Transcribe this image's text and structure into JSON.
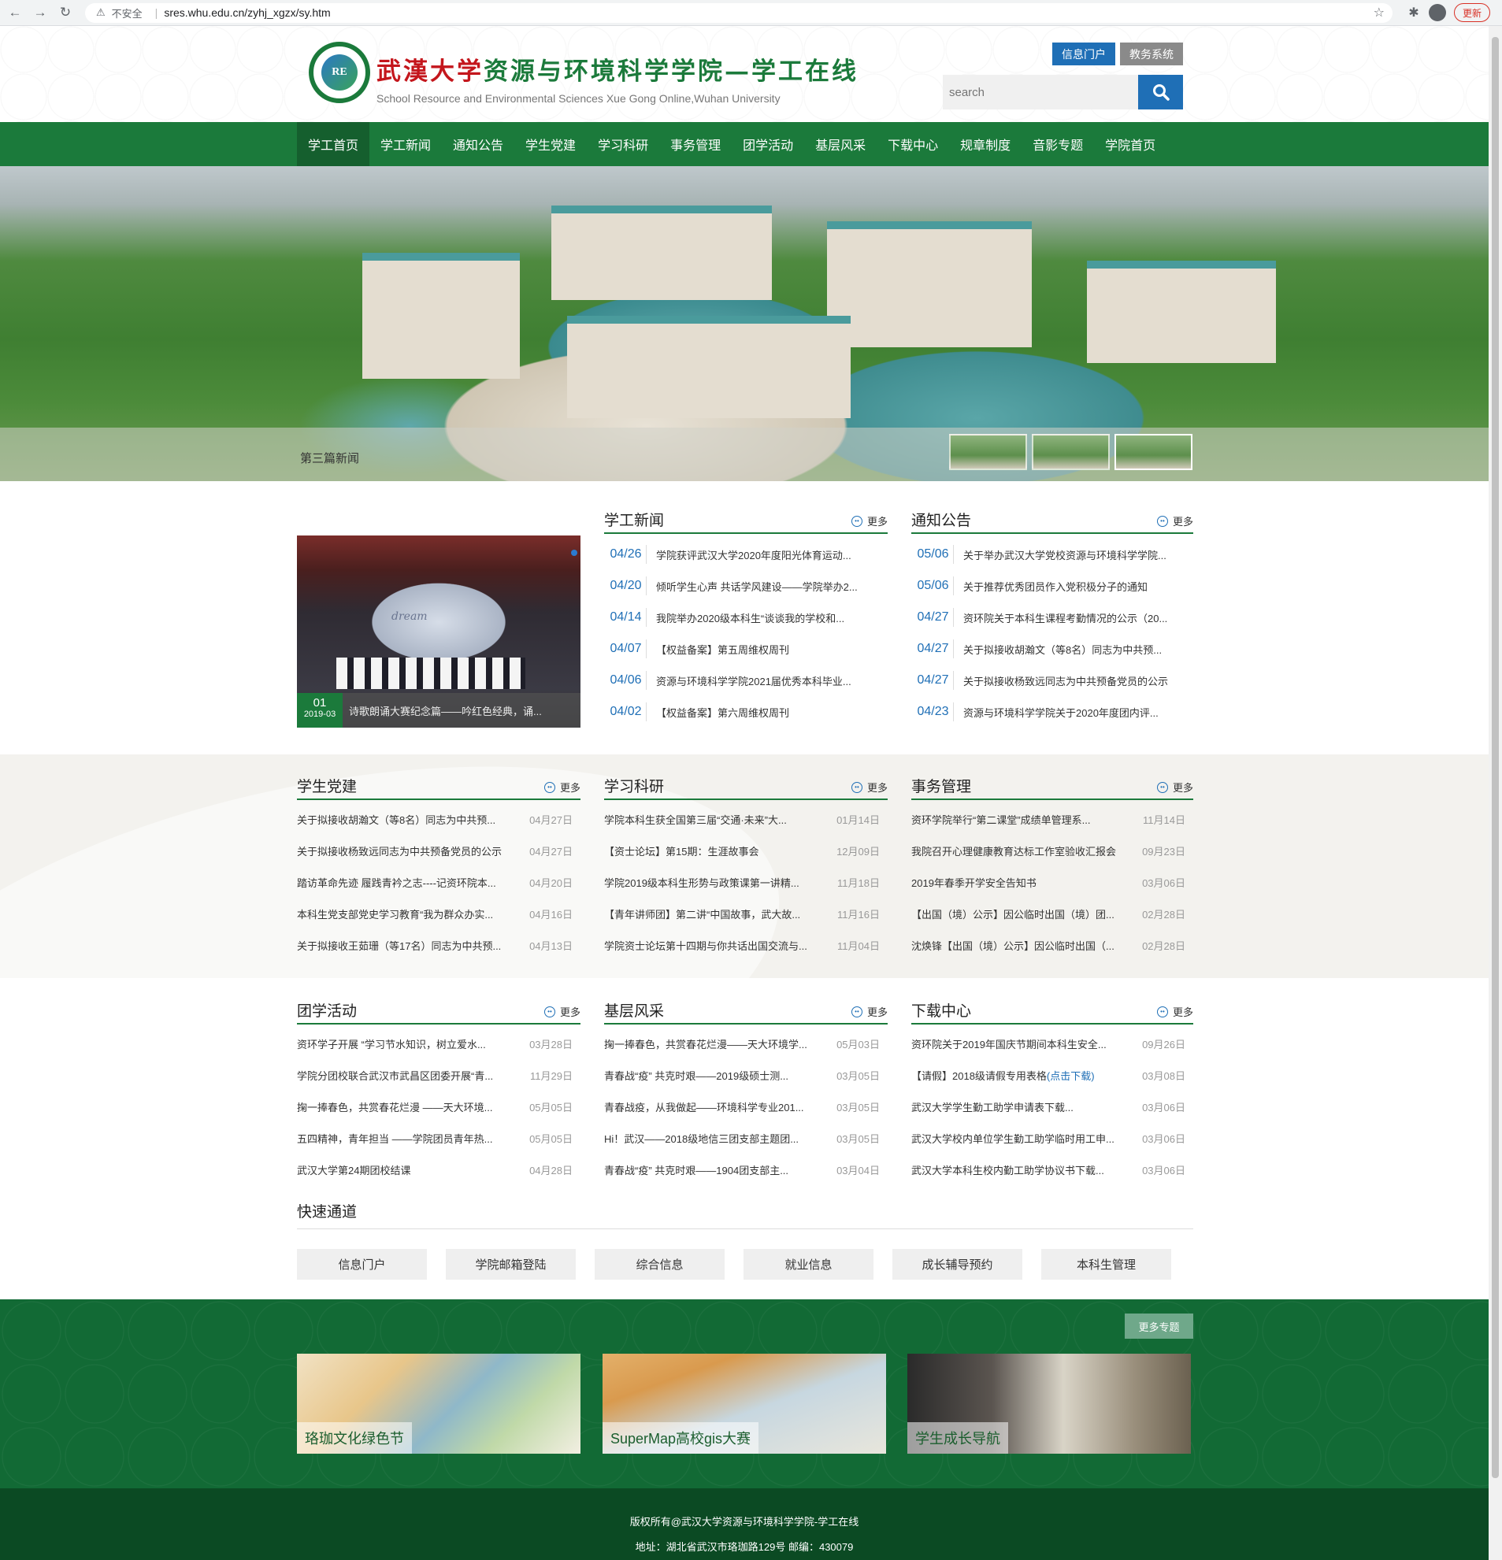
{
  "browser": {
    "security_label": "不安全",
    "url": "sres.whu.edu.cn/zyhj_xgzx/sy.htm",
    "update_label": "更新"
  },
  "header": {
    "logo_text": "RE",
    "title_university": "武漢大学",
    "title_college": "资源与环境科学学院—学工在线",
    "subtitle": "School Resource and Environmental Sciences Xue Gong Online,Wuhan University",
    "btn_info_portal": "信息门户",
    "btn_edu_system": "教务系统",
    "search_placeholder": "search"
  },
  "nav": {
    "items": [
      "学工首页",
      "学工新闻",
      "通知公告",
      "学生党建",
      "学习科研",
      "事务管理",
      "团学活动",
      "基层风采",
      "下载中心",
      "规章制度",
      "音影专题",
      "学院首页"
    ]
  },
  "banner": {
    "caption": "第三篇新闻"
  },
  "more_label": "更多",
  "feature": {
    "stage_text": "dream",
    "day": "01",
    "year_month": "2019-03",
    "caption": "诗歌朗诵大赛纪念篇——吟红色经典，诵..."
  },
  "xgxw": {
    "title": "学工新闻",
    "items": [
      {
        "date": "04/26",
        "text": "学院获评武汉大学2020年度阳光体育运动..."
      },
      {
        "date": "04/20",
        "text": "倾听学生心声 共话学风建设——学院举办2..."
      },
      {
        "date": "04/14",
        "text": "我院举办2020级本科生“谈谈我的学校和..."
      },
      {
        "date": "04/07",
        "text": "【权益备案】第五周维权周刊"
      },
      {
        "date": "04/06",
        "text": "资源与环境科学学院2021届优秀本科毕业..."
      },
      {
        "date": "04/02",
        "text": "【权益备案】第六周维权周刊"
      }
    ]
  },
  "tzgg": {
    "title": "通知公告",
    "items": [
      {
        "date": "05/06",
        "text": "关于举办武汉大学党校资源与环境科学学院..."
      },
      {
        "date": "05/06",
        "text": "关于推荐优秀团员作入党积极分子的通知"
      },
      {
        "date": "04/27",
        "text": "资环院关于本科生课程考勤情况的公示（20..."
      },
      {
        "date": "04/27",
        "text": "关于拟接收胡瀚文（等8名）同志为中共预..."
      },
      {
        "date": "04/27",
        "text": "关于拟接收杨致远同志为中共预备党员的公示"
      },
      {
        "date": "04/23",
        "text": "资源与环境科学学院关于2020年度团内评..."
      }
    ]
  },
  "xsdj": {
    "title": "学生党建",
    "items": [
      {
        "text": "关于拟接收胡瀚文（等8名）同志为中共预...",
        "date": "04月27日"
      },
      {
        "text": "关于拟接收杨致远同志为中共预备党员的公示",
        "date": "04月27日"
      },
      {
        "text": "踏访革命先迹 履践青衿之志----记资环院本...",
        "date": "04月20日"
      },
      {
        "text": "本科生党支部党史学习教育“我为群众办实...",
        "date": "04月16日"
      },
      {
        "text": "关于拟接收王茹珊（等17名）同志为中共预...",
        "date": "04月13日"
      }
    ]
  },
  "xxky": {
    "title": "学习科研",
    "items": [
      {
        "text": "学院本科生获全国第三届“交通·未来”大...",
        "date": "01月14日"
      },
      {
        "text": "【资士论坛】第15期：生涯故事会",
        "date": "12月09日"
      },
      {
        "text": "学院2019级本科生形势与政策课第一讲精...",
        "date": "11月18日"
      },
      {
        "text": "【青年讲师团】第二讲“中国故事，武大故...",
        "date": "11月16日"
      },
      {
        "text": "学院资士论坛第十四期与你共话出国交流与...",
        "date": "11月04日"
      }
    ]
  },
  "swgl": {
    "title": "事务管理",
    "items": [
      {
        "text": "资环学院举行“第二课堂”成绩单管理系...",
        "date": "11月14日"
      },
      {
        "text": "我院召开心理健康教育达标工作室验收汇报会",
        "date": "09月23日"
      },
      {
        "text": "2019年春季开学安全告知书",
        "date": "03月06日"
      },
      {
        "text": "【出国（境）公示】因公临时出国（境）团...",
        "date": "02月28日"
      },
      {
        "text": "沈焕锋【出国（境）公示】因公临时出国（...",
        "date": "02月28日"
      }
    ]
  },
  "txhd": {
    "title": "团学活动",
    "items": [
      {
        "text": "资环学子开展 “学习节水知识，树立爱水...",
        "date": "03月28日"
      },
      {
        "text": "学院分团校联合武汉市武昌区团委开展“青...",
        "date": "11月29日"
      },
      {
        "text": "掬一捧春色，共赏春花烂漫 ——天大环境...",
        "date": "05月05日"
      },
      {
        "text": "五四精神，青年担当 ——学院团员青年热...",
        "date": "05月05日"
      },
      {
        "text": "武汉大学第24期团校结课",
        "date": "04月28日"
      }
    ]
  },
  "jcfc": {
    "title": "基层风采",
    "items": [
      {
        "text": "掬一捧春色，共赏春花烂漫——天大环境学...",
        "date": "05月03日"
      },
      {
        "text": "青春战“疫” 共克时艰——2019级硕士测...",
        "date": "03月05日"
      },
      {
        "text": "青春战疫，从我做起——环境科学专业201...",
        "date": "03月05日"
      },
      {
        "text": "Hi！武汉——2018级地信三团支部主题团...",
        "date": "03月05日"
      },
      {
        "text": "青春战“疫” 共克时艰——1904团支部主...",
        "date": "03月04日"
      }
    ]
  },
  "xzzx": {
    "title": "下载中心",
    "items": [
      {
        "text": "资环院关于2019年国庆节期间本科生安全...",
        "date": "09月26日"
      },
      {
        "text": "【请假】2018级请假专用表格",
        "link": "(点击下载)",
        "date": "03月08日"
      },
      {
        "text": "武汉大学学生勤工助学申请表下载...",
        "date": "03月06日"
      },
      {
        "text": "武汉大学校内单位学生勤工助学临时用工申...",
        "date": "03月06日"
      },
      {
        "text": "武汉大学本科生校内勤工助学协议书下载...",
        "date": "03月06日"
      }
    ]
  },
  "quick": {
    "title": "快速通道",
    "items": [
      "信息门户",
      "学院邮箱登陆",
      "综合信息",
      "就业信息",
      "成长辅导预约",
      "本科生管理"
    ]
  },
  "topics": {
    "more_label": "更多专题",
    "cards": [
      "珞珈文化绿色节",
      "SuperMap高校gis大赛",
      "学生成长导航"
    ]
  },
  "footer": {
    "copyright": "版权所有@武汉大学资源与环境科学学院-学工在线",
    "address": "地址：湖北省武汉市珞珈路129号 邮编：430079"
  }
}
